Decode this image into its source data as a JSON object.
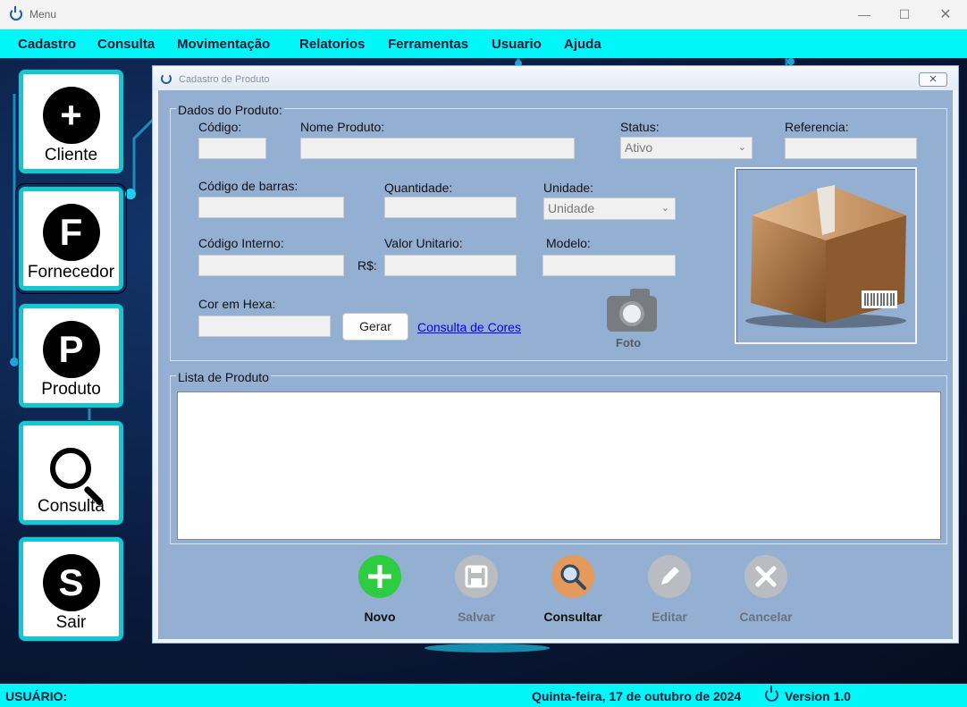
{
  "window": {
    "title": "Menu"
  },
  "menu": [
    "Cadastro",
    "Consulta",
    "Movimentação",
    "Relatorios",
    "Ferramentas",
    "Usuario",
    "Ajuda"
  ],
  "sidebar": [
    {
      "label": "Cliente",
      "glyph": "+",
      "icon": "plus-icon"
    },
    {
      "label": "Fornecedor",
      "glyph": "F",
      "icon": "letter-f-icon"
    },
    {
      "label": "Produto",
      "glyph": "P",
      "icon": "letter-p-icon"
    },
    {
      "label": "Consulta",
      "glyph": "",
      "icon": "magnifier-icon"
    },
    {
      "label": "Sair",
      "glyph": "S",
      "icon": "letter-s-icon"
    }
  ],
  "child": {
    "title": "Cadastro de Produto",
    "close_glyph": "✕",
    "group_dados": "Dados do Produto:",
    "labels": {
      "codigo": "Código:",
      "nome": "Nome Produto:",
      "status": "Status:",
      "referencia": "Referencia:",
      "barras": "Código de barras:",
      "quantidade": "Quantidade:",
      "unidade": "Unidade:",
      "interno": "Código Interno:",
      "valor": "Valor Unitario:",
      "moeda": "R$:",
      "modelo": "Modelo:",
      "cor": "Cor em Hexa:"
    },
    "values": {
      "codigo": "",
      "nome": "",
      "referencia": "",
      "barras": "",
      "quantidade": "",
      "interno": "",
      "valor": "",
      "modelo": "",
      "cor": ""
    },
    "status_selected": "Ativo",
    "unidade_selected": "Unidade",
    "gerar_label": "Gerar",
    "consulta_cores_link": "Consulta de Cores",
    "foto_label": "Foto",
    "group_lista": "Lista de Produto",
    "actions": [
      {
        "label": "Novo",
        "icon": "plus-circle-icon",
        "color": "#2ecc40",
        "label_color": "#111111",
        "glyph": "+"
      },
      {
        "label": "Salvar",
        "icon": "floppy-disk-icon",
        "color": "#b9bcc1",
        "label_color": "#6b7280",
        "glyph": ""
      },
      {
        "label": "Consultar",
        "icon": "search-icon",
        "color": "#e39a5c",
        "label_color": "#111111",
        "glyph": ""
      },
      {
        "label": "Editar",
        "icon": "pencil-icon",
        "color": "#b9bcc1",
        "label_color": "#6b7280",
        "glyph": "✎"
      },
      {
        "label": "Cancelar",
        "icon": "cancel-icon",
        "color": "#b9bcc1",
        "label_color": "#6b7280",
        "glyph": "✕"
      }
    ]
  },
  "status_bar": {
    "user_label": "USUÁRIO:",
    "date": "Quinta-feira, 17 de outubro de 2024",
    "version": "Version 1.0"
  },
  "colors": {
    "accent": "#00f7f7",
    "sidebar_border": "#15c7cf",
    "form_bg": "#93afd2"
  }
}
